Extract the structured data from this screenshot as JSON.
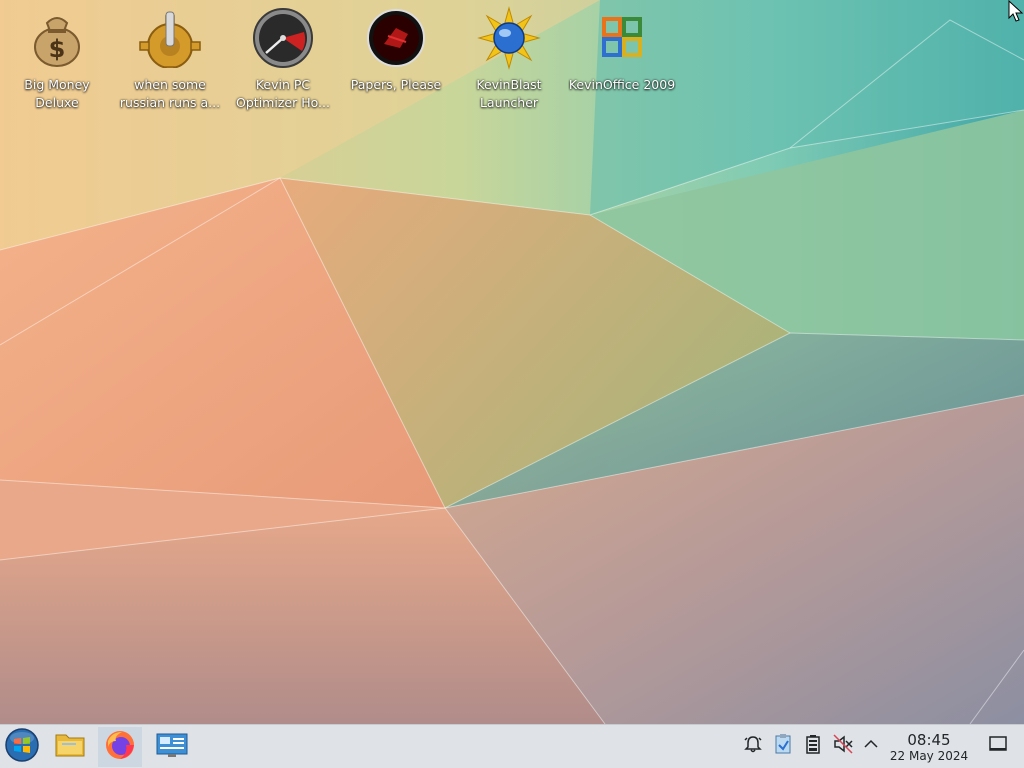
{
  "desktop": {
    "icons": [
      {
        "label": "Big Money Deluxe",
        "icon": "money-bag-icon"
      },
      {
        "label": "when some russian runs a...",
        "icon": "gear-joystick-icon"
      },
      {
        "label": "Kevin PC Optimizer Ho...",
        "icon": "speedometer-icon"
      },
      {
        "label": "Papers, Please",
        "icon": "papers-please-emblem-icon"
      },
      {
        "label": "KevinBlast Launcher",
        "icon": "globe-starburst-icon"
      },
      {
        "label": "KevinOffice 2009",
        "icon": "office-logo-icon"
      }
    ]
  },
  "taskbar": {
    "launchers": [
      {
        "name": "start-menu",
        "icon": "windows-orb-icon"
      },
      {
        "name": "file-manager",
        "icon": "folder-icon"
      },
      {
        "name": "firefox",
        "icon": "firefox-icon"
      },
      {
        "name": "system-monitor",
        "icon": "network-monitor-icon"
      }
    ],
    "tray": [
      "notifications-bell-icon",
      "clipboard-icon",
      "battery-icon",
      "volume-muted-icon",
      "expand-tray-icon"
    ],
    "clock": {
      "time": "08:45",
      "date": "22 May 2024"
    },
    "show_desktop": "show-desktop-icon"
  },
  "colors": {
    "taskbar_bg": "#dfe2e6",
    "active_task": "#cdd7e2"
  }
}
